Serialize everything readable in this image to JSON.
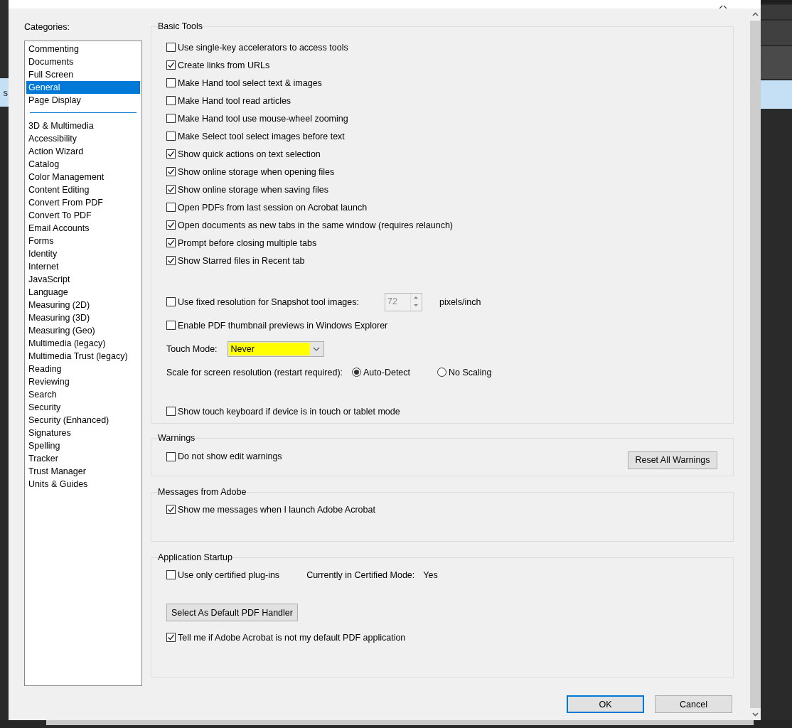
{
  "background_app": {
    "label": "s"
  },
  "categories": {
    "label": "Categories:",
    "groups": [
      {
        "items": [
          {
            "label": "Commenting",
            "selected": false
          },
          {
            "label": "Documents",
            "selected": false
          },
          {
            "label": "Full Screen",
            "selected": false
          },
          {
            "label": "General",
            "selected": true
          },
          {
            "label": "Page Display",
            "selected": false
          }
        ]
      },
      {
        "items": [
          {
            "label": "3D & Multimedia",
            "selected": false
          },
          {
            "label": "Accessibility",
            "selected": false
          },
          {
            "label": "Action Wizard",
            "selected": false
          },
          {
            "label": "Catalog",
            "selected": false
          },
          {
            "label": "Color Management",
            "selected": false
          },
          {
            "label": "Content Editing",
            "selected": false
          },
          {
            "label": "Convert From PDF",
            "selected": false
          },
          {
            "label": "Convert To PDF",
            "selected": false
          },
          {
            "label": "Email Accounts",
            "selected": false
          },
          {
            "label": "Forms",
            "selected": false
          },
          {
            "label": "Identity",
            "selected": false
          },
          {
            "label": "Internet",
            "selected": false
          },
          {
            "label": "JavaScript",
            "selected": false
          },
          {
            "label": "Language",
            "selected": false
          },
          {
            "label": "Measuring (2D)",
            "selected": false
          },
          {
            "label": "Measuring (3D)",
            "selected": false
          },
          {
            "label": "Measuring (Geo)",
            "selected": false
          },
          {
            "label": "Multimedia (legacy)",
            "selected": false
          },
          {
            "label": "Multimedia Trust (legacy)",
            "selected": false
          },
          {
            "label": "Reading",
            "selected": false
          },
          {
            "label": "Reviewing",
            "selected": false
          },
          {
            "label": "Search",
            "selected": false
          },
          {
            "label": "Security",
            "selected": false
          },
          {
            "label": "Security (Enhanced)",
            "selected": false
          },
          {
            "label": "Signatures",
            "selected": false
          },
          {
            "label": "Spelling",
            "selected": false
          },
          {
            "label": "Tracker",
            "selected": false
          },
          {
            "label": "Trust Manager",
            "selected": false
          },
          {
            "label": "Units & Guides",
            "selected": false
          }
        ]
      }
    ]
  },
  "basic_tools": {
    "title": "Basic Tools",
    "options": [
      {
        "label": "Use single-key accelerators to access tools",
        "checked": false
      },
      {
        "label": "Create links from URLs",
        "checked": true
      },
      {
        "label": "Make Hand tool select text & images",
        "checked": false
      },
      {
        "label": "Make Hand tool read articles",
        "checked": false
      },
      {
        "label": "Make Hand tool use mouse-wheel zooming",
        "checked": false
      },
      {
        "label": "Make Select tool select images before text",
        "checked": false
      },
      {
        "label": "Show quick actions on text selection",
        "checked": true
      },
      {
        "label": "Show online storage when opening files",
        "checked": true
      },
      {
        "label": "Show online storage when saving files",
        "checked": true
      },
      {
        "label": "Open PDFs from last session on Acrobat launch",
        "checked": false
      },
      {
        "label": "Open documents as new tabs in the same window (requires relaunch)",
        "checked": true
      },
      {
        "label": "Prompt before closing multiple tabs",
        "checked": true
      },
      {
        "label": "Show Starred files in Recent tab",
        "checked": true
      }
    ],
    "snapshot": {
      "label": "Use fixed resolution for Snapshot tool images:",
      "checked": false,
      "value": "72",
      "disabled": true,
      "unit": "pixels/inch"
    },
    "thumbnails": {
      "label": "Enable PDF thumbnail previews in Windows Explorer",
      "checked": false
    },
    "touch_mode": {
      "label": "Touch Mode:",
      "value": "Never"
    },
    "scale": {
      "label": "Scale for screen resolution (restart required):",
      "options": [
        {
          "label": "Auto-Detect",
          "selected": true
        },
        {
          "label": "No Scaling",
          "selected": false
        }
      ]
    },
    "touch_keyboard": {
      "label": "Show touch keyboard if device is in touch or tablet mode",
      "checked": false
    }
  },
  "warnings": {
    "title": "Warnings",
    "option": {
      "label": "Do not show edit warnings",
      "checked": false
    },
    "button": "Reset All Warnings"
  },
  "messages": {
    "title": "Messages from Adobe",
    "option": {
      "label": "Show me messages when I launch Adobe Acrobat",
      "checked": true
    }
  },
  "startup": {
    "title": "Application Startup",
    "option": {
      "label": "Use only certified plug-ins",
      "checked": false
    },
    "mode_label": "Currently in Certified Mode:",
    "mode_value": "Yes",
    "button": "Select As Default PDF Handler",
    "default_option": {
      "label": "Tell me if Adobe Acrobat is not my default PDF application",
      "checked": true
    }
  },
  "buttons": [
    {
      "label": "OK",
      "kind": "default"
    },
    {
      "label": "Cancel",
      "kind": "normal"
    }
  ]
}
